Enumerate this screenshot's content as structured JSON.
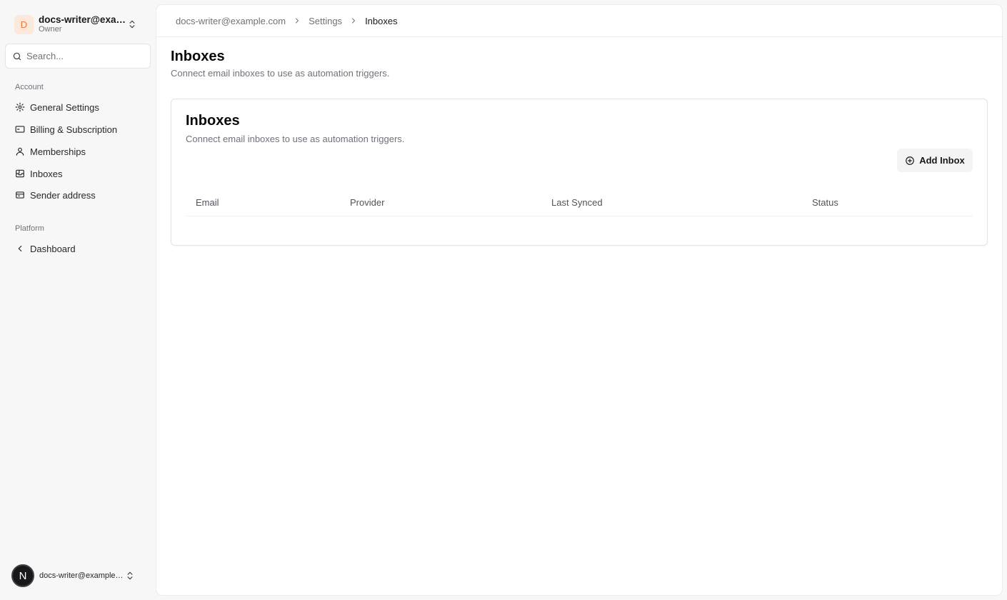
{
  "org": {
    "avatar_letter": "D",
    "name": "docs-writer@example.com",
    "role": "Owner"
  },
  "search": {
    "placeholder": "Search..."
  },
  "nav": {
    "account_label": "Account",
    "account_items": [
      {
        "label": "General Settings",
        "icon": "gear-icon"
      },
      {
        "label": "Billing & Subscription",
        "icon": "credit-card-icon"
      },
      {
        "label": "Memberships",
        "icon": "user-icon"
      },
      {
        "label": "Inboxes",
        "icon": "inbox-icon"
      },
      {
        "label": "Sender address",
        "icon": "mailbox-icon"
      }
    ],
    "platform_label": "Platform",
    "platform_items": [
      {
        "label": "Dashboard",
        "icon": "chevron-left-icon"
      }
    ]
  },
  "user": {
    "avatar_letter": "N",
    "email": "docs-writer@example.com"
  },
  "breadcrumb": {
    "items": [
      "docs-writer@example.com",
      "Settings",
      "Inboxes"
    ]
  },
  "page": {
    "title": "Inboxes",
    "description": "Connect email inboxes to use as automation triggers."
  },
  "card": {
    "title": "Inboxes",
    "description": "Connect email inboxes to use as automation triggers.",
    "add_button": "Add Inbox",
    "columns": [
      "Email",
      "Provider",
      "Last Synced",
      "Status"
    ],
    "rows": []
  }
}
